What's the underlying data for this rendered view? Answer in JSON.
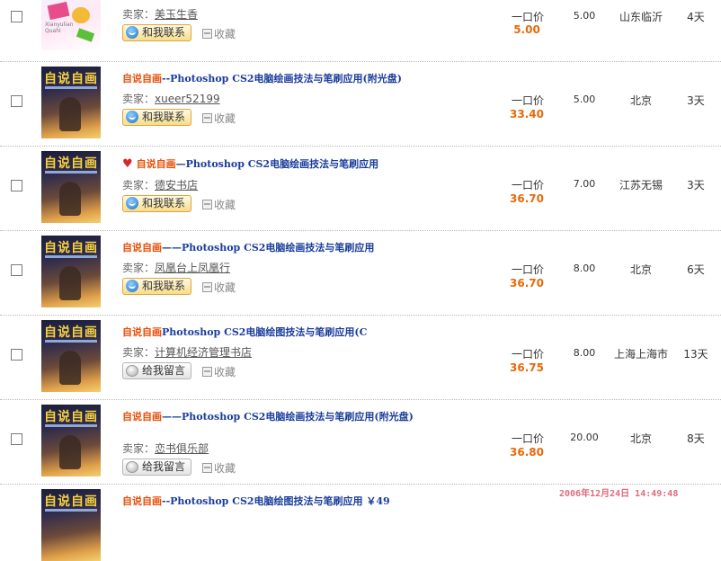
{
  "items": [
    {
      "title_highlight": "",
      "title_rest": "",
      "heart": false,
      "seller_label": "卖家：",
      "seller": "美玉生香",
      "action_type": "contact",
      "action_label": "和我联系",
      "fav_label": "收藏",
      "price_type": "一口价",
      "price": "5.00",
      "shipping": "5.00",
      "location": "山东临沂",
      "days_left": "4天",
      "thumb_type": "first",
      "thumb_title": "",
      "thumb_caption": "Xianyulian Quahi"
    },
    {
      "title_highlight": "自说自画",
      "title_rest": "--Photoshop CS2电脑绘画技法与笔刷应用(附光盘)",
      "heart": false,
      "seller_label": "卖家：",
      "seller": "xueer52199",
      "action_type": "contact",
      "action_label": "和我联系",
      "fav_label": "收藏",
      "price_type": "一口价",
      "price": "33.40",
      "shipping": "5.00",
      "location": "北京",
      "days_left": "3天",
      "thumb_type": "book",
      "thumb_title": "自说自画"
    },
    {
      "title_highlight": "自说自画",
      "title_rest": "—Photoshop CS2电脑绘画技法与笔刷应用",
      "heart": true,
      "heart_icon": "heart-icon",
      "seller_label": "卖家：",
      "seller": "德安书店",
      "action_type": "contact",
      "action_label": "和我联系",
      "fav_label": "收藏",
      "price_type": "一口价",
      "price": "36.70",
      "shipping": "7.00",
      "location": "江苏无锡",
      "days_left": "3天",
      "thumb_type": "book",
      "thumb_title": "自说自画"
    },
    {
      "title_highlight": "自说自画",
      "title_rest": "——Photoshop CS2电脑绘画技法与笔刷应用",
      "heart": false,
      "seller_label": "卖家：",
      "seller": "凤凰台上凤凰行",
      "action_type": "contact",
      "action_label": "和我联系",
      "fav_label": "收藏",
      "price_type": "一口价",
      "price": "36.70",
      "shipping": "8.00",
      "location": "北京",
      "days_left": "6天",
      "thumb_type": "book",
      "thumb_title": "自说自画"
    },
    {
      "title_highlight": "自说自画",
      "title_rest": "Photoshop CS2电脑绘图技法与笔刷应用(C",
      "heart": false,
      "seller_label": "卖家：",
      "seller": "计算机经济管理书店",
      "action_type": "message",
      "action_label": "给我留言",
      "fav_label": "收藏",
      "price_type": "一口价",
      "price": "36.75",
      "shipping": "8.00",
      "location": "上海上海市",
      "days_left": "13天",
      "thumb_type": "book",
      "thumb_title": "自说自画"
    },
    {
      "title_highlight": "自说自画",
      "title_rest": "——Photoshop CS2电脑绘画技法与笔刷应用(附光盘)",
      "heart": false,
      "seller_label": "卖家：",
      "seller": "恋书俱乐部",
      "action_type": "message",
      "action_label": "给我留言",
      "fav_label": "收藏",
      "price_type": "一口价",
      "price": "36.80",
      "shipping": "20.00",
      "location": "北京",
      "days_left": "8天",
      "thumb_type": "book",
      "thumb_title": "自说自画"
    },
    {
      "title_highlight": "自说自画",
      "title_rest": "--Photoshop CS2电脑绘图技法与笔刷应用 ￥49",
      "heart": false,
      "partial": true,
      "thumb_type": "book",
      "thumb_title": "自说自画"
    }
  ],
  "datetime": "2006年12月24日 14:49:48 ",
  "colors": {
    "title_highlight": "#e8500a",
    "title_link": "#1a3d9a",
    "price": "#e8690a",
    "datetime": "#e06a7c"
  }
}
